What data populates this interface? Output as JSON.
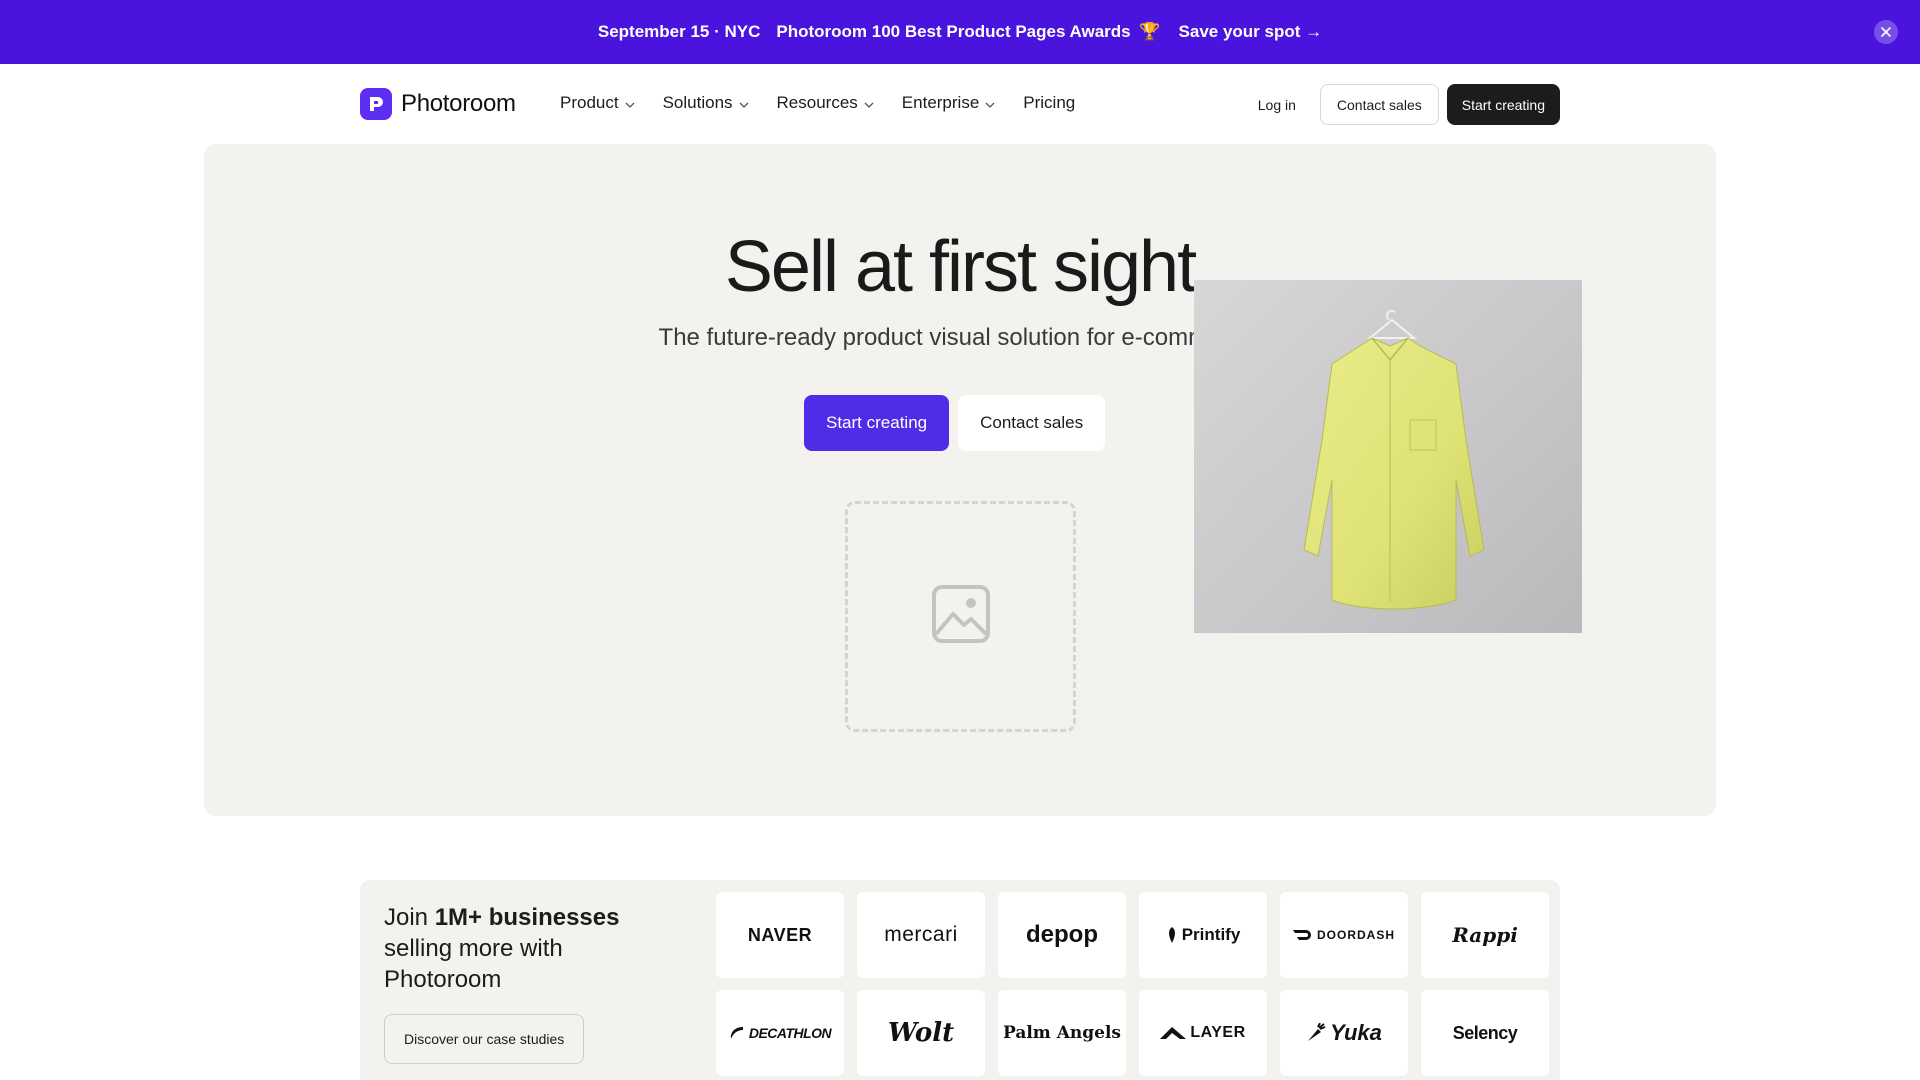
{
  "banner": {
    "date": "September 15 · NYC",
    "award": "Photoroom 100 Best Product Pages Awards",
    "trophy": "🏆",
    "cta": "Save your spot →"
  },
  "nav": {
    "brand": "Photoroom",
    "items": [
      {
        "label": "Product"
      },
      {
        "label": "Solutions"
      },
      {
        "label": "Resources"
      },
      {
        "label": "Enterprise"
      },
      {
        "label": "Pricing"
      }
    ],
    "login": "Log in",
    "contact": "Contact sales",
    "start": "Start creating"
  },
  "hero": {
    "title": "Sell at first sight",
    "subtitle": "The future-ready product visual solution for e-commerce.",
    "primary_cta": "Start creating",
    "secondary_cta": "Contact sales"
  },
  "trust": {
    "prefix": "Join ",
    "highlight": "1M+ businesses",
    "suffix": " selling more with Photoroom",
    "case_button": "Discover our case studies",
    "brands": [
      "NAVER",
      "mercari",
      "depop",
      "Printify",
      "DOORDASH",
      "Rappi",
      "DECATHLON",
      "Wolt",
      "Palm Angels",
      "LAYER",
      "Yuka",
      "Selency"
    ]
  },
  "colors": {
    "banner": "#4a14de",
    "primary": "#4f2ce8",
    "hero_bg": "#f3f2ef",
    "dark_button": "#1c1c1c"
  }
}
